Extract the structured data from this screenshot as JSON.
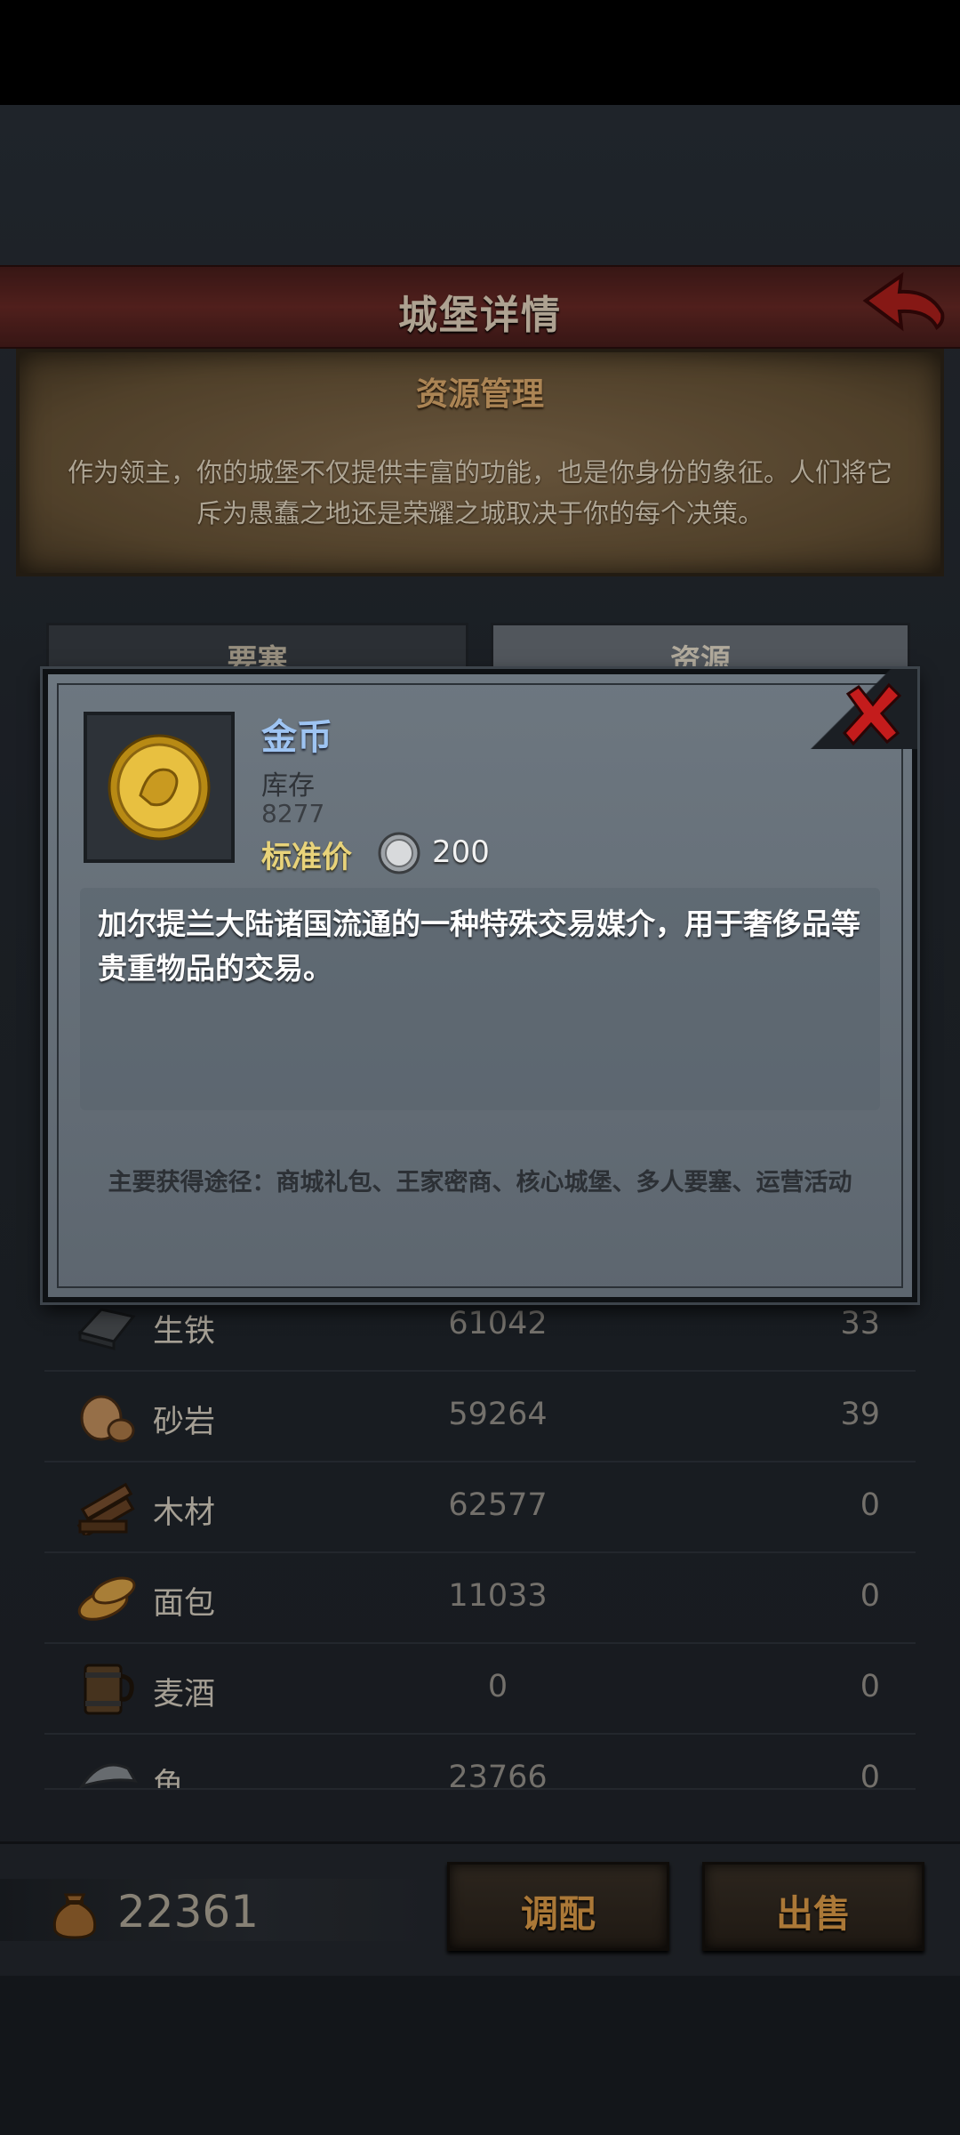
{
  "header": {
    "title": "城堡详情"
  },
  "info": {
    "title": "资源管理",
    "description": "作为领主，你的城堡不仅提供丰富的功能，也是你身份的象征。人们将它斥为愚蠢之地还是荣耀之城取决于你的每个决策。"
  },
  "tabs": [
    {
      "label": "要塞"
    },
    {
      "label": "资源"
    }
  ],
  "resources": [
    {
      "name": "生铁",
      "stock": "61042",
      "prod": "33",
      "icon": "iron-ingot-icon"
    },
    {
      "name": "砂岩",
      "stock": "59264",
      "prod": "39",
      "icon": "sandstone-icon"
    },
    {
      "name": "木材",
      "stock": "62577",
      "prod": "0",
      "icon": "wood-icon"
    },
    {
      "name": "面包",
      "stock": "11033",
      "prod": "0",
      "icon": "bread-icon"
    },
    {
      "name": "麦酒",
      "stock": "0",
      "prod": "0",
      "icon": "ale-mug-icon"
    },
    {
      "name": "鱼",
      "stock": "23766",
      "prod": "0",
      "icon": "fish-icon"
    }
  ],
  "footer": {
    "gold_total": "22361",
    "dispatch_label": "调配",
    "sell_label": "出售"
  },
  "modal": {
    "item_name": "金币",
    "stock_label": "库存",
    "stock_value": "8277",
    "price_label": "标准价",
    "price_value": "200",
    "description": "加尔提兰大陆诸国流通的一种特殊交易媒介，用于奢侈品等贵重物品的交易。",
    "source": "主要获得途径：商城礼包、王家密商、核心城堡、多人要塞、运营活动"
  },
  "colors": {
    "accent_orange": "#e5a04a",
    "item_name_blue": "#9ec4f2",
    "price_gold": "#e8d37a",
    "title_red": "#6b2a26"
  }
}
